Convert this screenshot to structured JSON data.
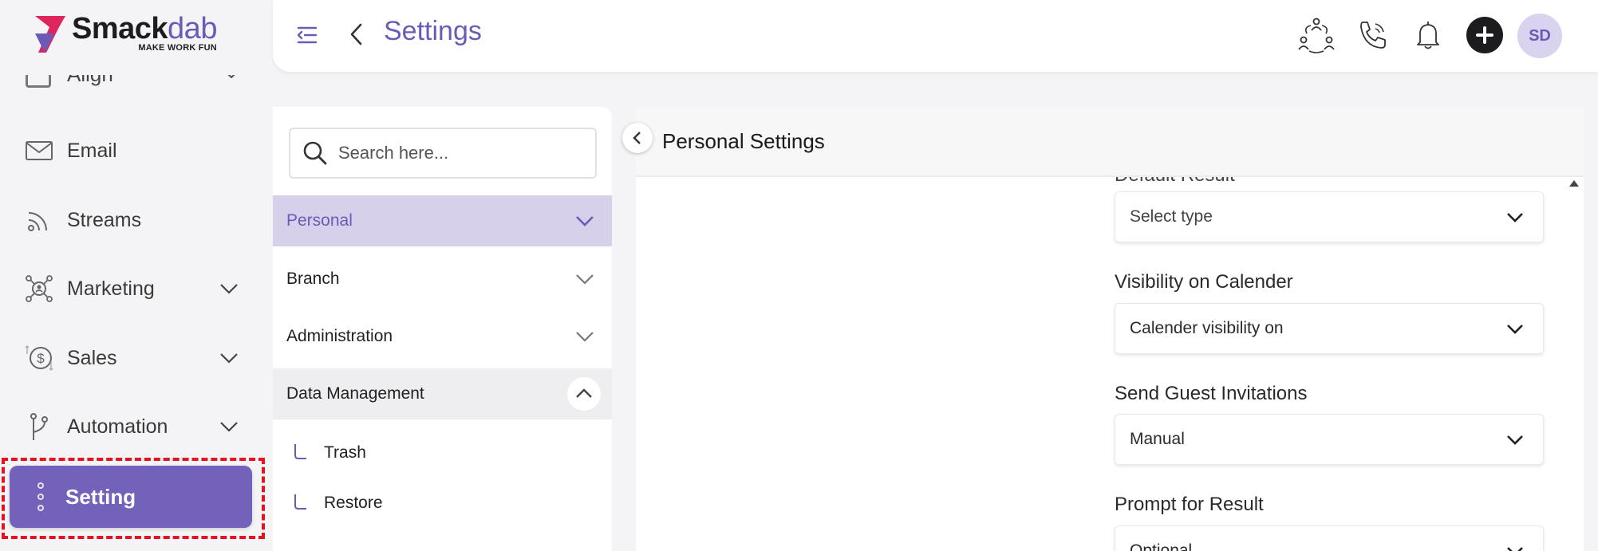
{
  "app": {
    "logo_name": "Smack",
    "logo_name_light": "dab",
    "logo_tagline": "MAKE WORK FUN"
  },
  "left_nav": {
    "partial_item_label": "Align",
    "items": [
      {
        "label": "Email",
        "icon": "mail-icon"
      },
      {
        "label": "Streams",
        "icon": "streams-icon"
      },
      {
        "label": "Marketing",
        "icon": "marketing-icon"
      },
      {
        "label": "Sales",
        "icon": "dollar-icon"
      },
      {
        "label": "Automation",
        "icon": "automation-icon"
      }
    ],
    "active_item": {
      "label": "Setting",
      "icon": "dots-vertical-icon"
    }
  },
  "header": {
    "title": "Settings",
    "avatar_initials": "SD"
  },
  "settings_panel": {
    "search_placeholder": "Search here...",
    "categories": [
      {
        "label": "Personal"
      },
      {
        "label": "Branch"
      },
      {
        "label": "Administration"
      },
      {
        "label": "Data Management"
      }
    ],
    "data_management_items": [
      {
        "label": "Trash"
      },
      {
        "label": "Restore"
      }
    ]
  },
  "content": {
    "title": "Personal Settings",
    "cut_label": "Default Result",
    "fields": [
      {
        "value": "Select type"
      },
      {
        "label": "Visibility on Calender",
        "value": "Calender visibility on"
      },
      {
        "label": "Send Guest Invitations",
        "value": "Manual"
      },
      {
        "label": "Prompt for Result",
        "value": "Optional"
      }
    ]
  },
  "colors": {
    "accent": "#7461b9",
    "accent_text": "#6b5bb6",
    "active_bg": "#d6d0eb",
    "highlight_outline": "#e3131f"
  }
}
